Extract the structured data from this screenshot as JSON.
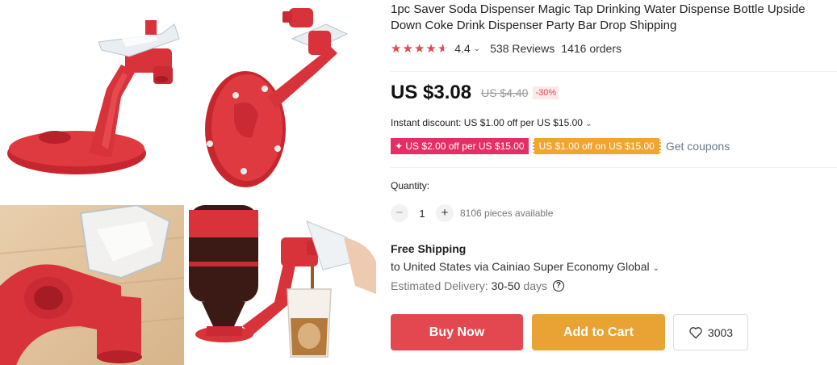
{
  "product": {
    "title": "1pc Saver Soda Dispenser Magic Tap Drinking Water Dispense Bottle Upside Down Coke Drink Dispenser Party Bar Drop Shipping",
    "rating": "4.4",
    "rating_fraction": 0.88,
    "reviews": "538 Reviews",
    "orders": "1416 orders"
  },
  "price": {
    "current": "US $3.08",
    "original": "US $4.40",
    "discount": "-30%"
  },
  "promotions": {
    "instant_discount": "Instant discount: US $1.00 off per US $15.00",
    "coupon_1": "✦ US $2.00 off per US $15.00",
    "coupon_2": "US $1.00 off on US $15.00",
    "get_coupons": "Get coupons"
  },
  "quantity": {
    "label": "Quantity:",
    "value": "1",
    "minus": "−",
    "plus": "+",
    "available": "8106 pieces available"
  },
  "shipping": {
    "title": "Free Shipping",
    "destination": "to United States via Cainiao Super Economy Global",
    "delivery_label": "Estimated Delivery:",
    "delivery_days": "30-50",
    "delivery_unit": "days",
    "help_icon": "?"
  },
  "actions": {
    "buy_now": "Buy Now",
    "add_to_cart": "Add to Cart",
    "wishlist_count": "3003"
  },
  "colors": {
    "accent_red": "#e34850",
    "cart_orange": "#e8a334",
    "coupon_pink": "#e62e66",
    "product_red": "#d8323a"
  },
  "icons": [
    "star-icon",
    "chevron-down-icon",
    "question-icon",
    "heart-icon",
    "minus-icon",
    "plus-icon"
  ]
}
